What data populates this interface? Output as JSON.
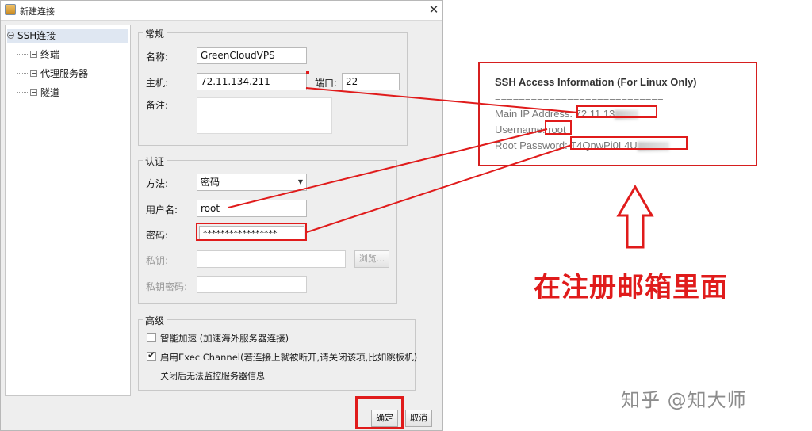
{
  "window": {
    "title": "新建连接",
    "close_glyph": "✕"
  },
  "tree": {
    "root": "SSH连接",
    "children": [
      "终端",
      "代理服务器",
      "隧道"
    ]
  },
  "general": {
    "title": "常规",
    "name_label": "名称:",
    "name_value": "GreenCloudVPS",
    "host_label": "主机:",
    "host_value": "72.11.134.211",
    "port_label": "端口:",
    "port_value": "22",
    "note_label": "备注:",
    "note_value": ""
  },
  "auth": {
    "title": "认证",
    "method_label": "方法:",
    "method_value": "密码",
    "user_label": "用户名:",
    "user_value": "root",
    "pass_label": "密码:",
    "pass_value": "*****************",
    "key_label": "私钥:",
    "key_value": "",
    "browse_label": "浏览...",
    "keypass_label": "私钥密码:",
    "keypass_value": ""
  },
  "advanced": {
    "title": "高级",
    "smart_accel_label": "智能加速 (加速海外服务器连接)",
    "smart_accel_checked": false,
    "exec_channel_label": "启用Exec Channel(若连接上就被断开,请关闭该项,比如跳板机)",
    "exec_channel_checked": true,
    "exec_note": "关闭后无法监控服务器信息"
  },
  "buttons": {
    "ok": "确定",
    "cancel": "取消"
  },
  "info_box": {
    "title": "SSH Access Information (For Linux Only)",
    "separator": "============================",
    "ip_label": "Main IP Address:",
    "ip_value": "72.11.13",
    "user_label": "Username:",
    "user_value": "root",
    "pass_label": "Root Password:",
    "pass_value": "T4QnwPi0L4U"
  },
  "annotation": "在注册邮箱里面",
  "watermark": "知乎 @知大师",
  "colors": {
    "annotation_red": "#e01b1b",
    "dialog_bg": "#eeeeee"
  }
}
